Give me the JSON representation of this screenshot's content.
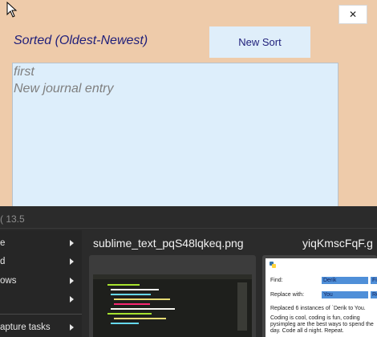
{
  "window": {
    "title": "Sorted (Oldest-Newest)",
    "new_sort_label": "New Sort",
    "close_glyph": "✕"
  },
  "entries": [
    "first",
    "New journal entry"
  ],
  "taskbar": {
    "title": "( 13.5",
    "menu_items": [
      {
        "label": "e",
        "icon": "chevron-right-icon"
      },
      {
        "label": "d",
        "icon": "chevron-right-icon"
      },
      {
        "label": "ows",
        "icon": "chevron-right-icon"
      },
      {
        "label": "",
        "icon": "chevron-right-icon"
      },
      {
        "label": "apture tasks",
        "icon": "chevron-right-icon"
      }
    ],
    "thumbnails": [
      {
        "name": "sublime_text_pqS48lqkeq.png"
      },
      {
        "name": "yiqKmscFqF.g",
        "find_label": "Find:",
        "find_value": "Derik",
        "find_button": "Fi",
        "replace_label": "Replace with:",
        "replace_value": "You",
        "replace_button": "Re",
        "status": "Replaced 6 instances of `Derik to You.",
        "body": "Coding is cool, coding is fun, coding pysimpleg are the best ways to spend the day. Code all d night. Repeat."
      }
    ]
  },
  "colors": {
    "background": "#eecbaa",
    "accent_text": "#1e1e7a",
    "list_bg": "#ddeefb",
    "button_bg": "#dfeefa"
  }
}
